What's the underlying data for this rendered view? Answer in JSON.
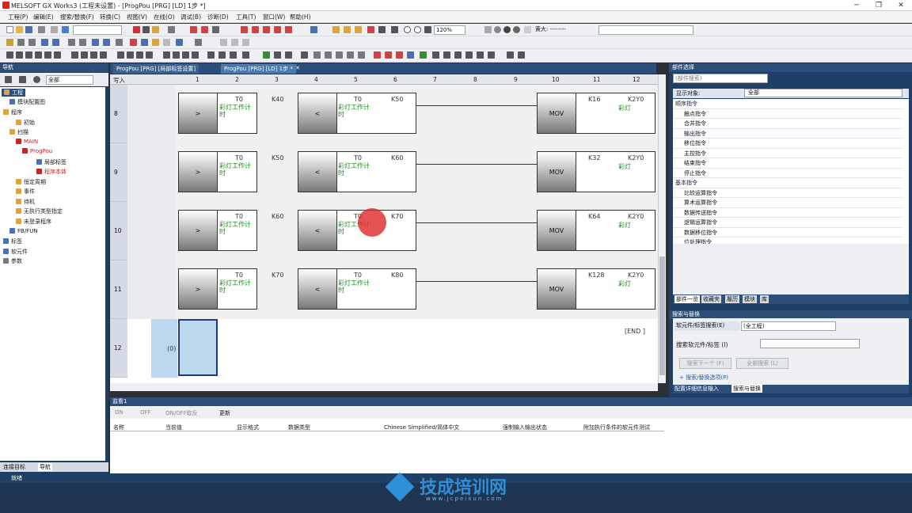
{
  "title": "MELSOFT GX Works3 (工程未设置) - [ProgPou [PRG] [LD] 1步 *]",
  "menu": [
    "工程(P)",
    "编辑(E)",
    "搜索/替换(F)",
    "转换(C)",
    "视图(V)",
    "在线(O)",
    "调试(B)",
    "诊断(D)",
    "工具(T)",
    "窗口(W)",
    "帮助(H)"
  ],
  "toolbar": {
    "zoom": "120%",
    "mode_label": "黄大: --------"
  },
  "nav": {
    "header": "导航",
    "filter": "全部",
    "tree": [
      "工程",
      "模块配置图",
      "程序",
      "初始",
      "扫描",
      "MAIN",
      "ProgPou",
      "局部标签",
      "程序本体",
      "恒定周期",
      "事件",
      "待机",
      "无执行类型指定",
      "未登录程序",
      "FB/FUN",
      "标签",
      "软元件",
      "参数"
    ],
    "tabs": [
      "连接目标",
      "导航"
    ]
  },
  "tabs": {
    "tab1": "ProgPou [PRG] [局部标签设置]",
    "tab2": "ProgPou [PRG] [LD] 1步 *"
  },
  "editor": {
    "header_mode": "写入",
    "columns": [
      "1",
      "2",
      "3",
      "4",
      "5",
      "6",
      "7",
      "8",
      "9",
      "10",
      "11",
      "12"
    ],
    "rows": [
      {
        "num": "8",
        "t1": "T0",
        "k1": "K40",
        "t2": "T0",
        "k2": "K50",
        "k3": "K16",
        "y": "K2Y0"
      },
      {
        "num": "9",
        "t1": "T0",
        "k1": "K50",
        "t2": "T0",
        "k2": "K60",
        "k3": "K32",
        "y": "K2Y0"
      },
      {
        "num": "10",
        "t1": "T0",
        "k1": "K60",
        "t2": "T0",
        "k2": "K70",
        "k3": "K64",
        "y": "K2Y0"
      },
      {
        "num": "11",
        "t1": "T0",
        "k1": "K70",
        "t2": "T0",
        "k2": "K80",
        "k3": "K128",
        "y": "K2Y0"
      }
    ],
    "gt": ">",
    "lt": "<",
    "mov": "MOV",
    "comment": "彩灯工作计时",
    "ycomment": "彩灯",
    "row12": "12",
    "row12_count": "(0)",
    "end": "[END ]"
  },
  "parts": {
    "header": "部件选择",
    "search_placeholder": "(部件搜索)",
    "display_target_label": "显示对象:",
    "display_target": "全部",
    "list": [
      {
        "label": "顺序指令",
        "cat": true
      },
      {
        "label": "触点指令"
      },
      {
        "label": "合并指令"
      },
      {
        "label": "输出指令"
      },
      {
        "label": "移位指令"
      },
      {
        "label": "主控指令"
      },
      {
        "label": "结束指令"
      },
      {
        "label": "停止指令"
      },
      {
        "label": "基本指令",
        "cat": true
      },
      {
        "label": "比较运算指令"
      },
      {
        "label": "算术运算指令"
      },
      {
        "label": "数据传送指令"
      },
      {
        "label": "逻辑运算指令"
      },
      {
        "label": "数据移位指令"
      },
      {
        "label": "位处理指令"
      }
    ],
    "tabs": [
      "部件一览",
      "收藏夹",
      "履历",
      "模块",
      "库"
    ]
  },
  "search": {
    "header": "搜索与替换",
    "type": "软元件/标签搜索(E)",
    "scope": "(全工程)",
    "field_label": "搜索软元件/标签 (I)",
    "next": "搜索下一个 (F)",
    "all": "全部搜索 (L)",
    "link": "+ 搜索/替换选项(P)",
    "tabs": [
      "配置详细信息输入",
      "搜索与替换"
    ]
  },
  "watch": {
    "header": "监看1",
    "tools": [
      "ON",
      "OFF",
      "ON/OFF取反",
      "更新"
    ],
    "columns": [
      "名称",
      "当前值",
      "显示格式",
      "数据类型",
      "Chinese Simplified/简体中文",
      "强制输入输出状态",
      "附加执行条件的软元件测试"
    ]
  },
  "status": "就绪",
  "brand": {
    "name": "技成培训网",
    "url": "www.jcpeixun.com"
  }
}
